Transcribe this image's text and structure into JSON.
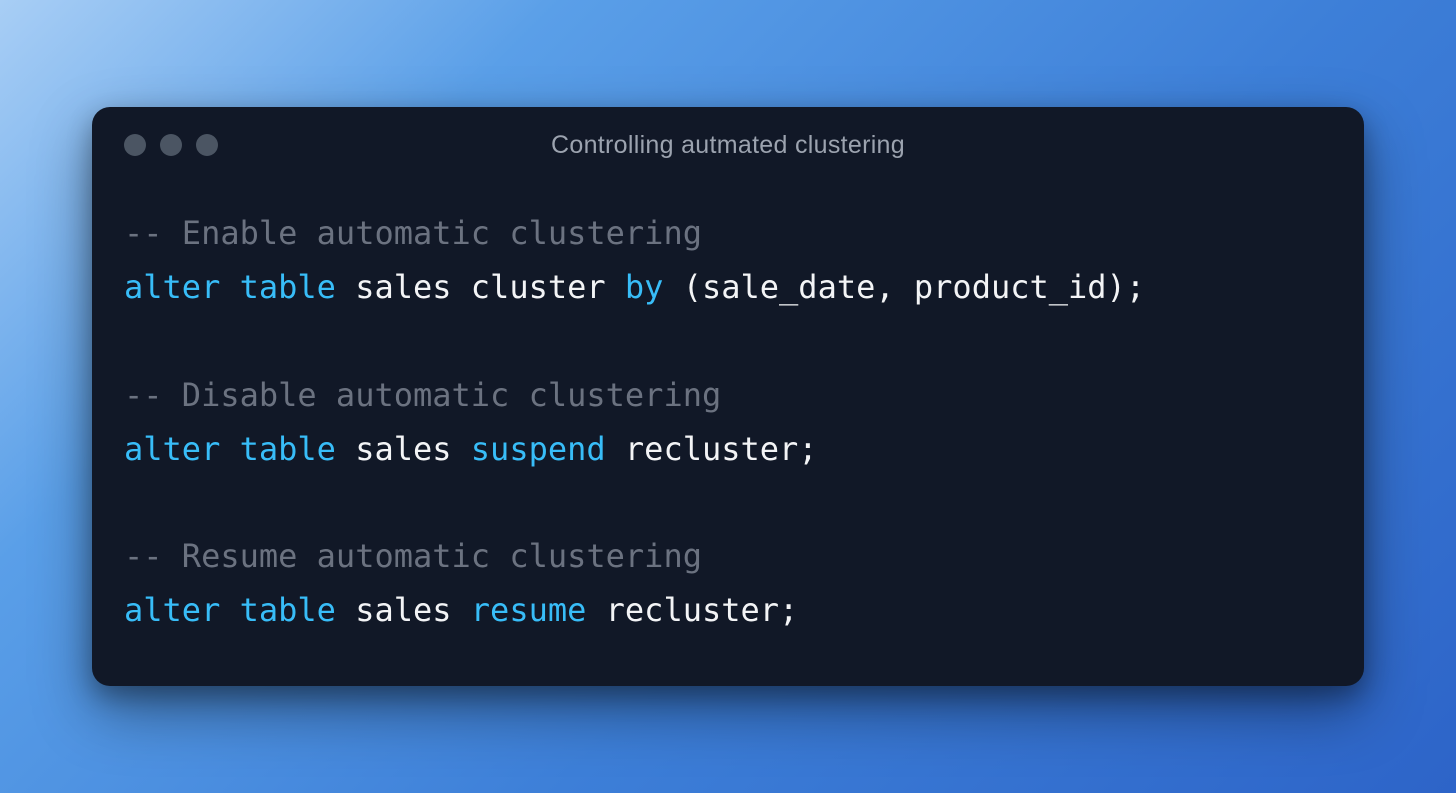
{
  "window": {
    "title": "Controlling autmated clustering"
  },
  "code": {
    "line1_comment": "-- Enable automatic clustering",
    "line2_kw1": "alter",
    "line2_kw2": "table",
    "line2_p1": " sales cluster ",
    "line2_kw3": "by",
    "line2_p2": " (sale_date, product_id);",
    "line3_comment": "-- Disable automatic clustering",
    "line4_kw1": "alter",
    "line4_kw2": "table",
    "line4_p1": " sales ",
    "line4_kw3": "suspend",
    "line4_p2": " recluster;",
    "line5_comment": "-- Resume automatic clustering",
    "line6_kw1": "alter",
    "line6_kw2": "table",
    "line6_p1": " sales ",
    "line6_kw3": "resume",
    "line6_p2": " recluster;"
  },
  "colors": {
    "windowBg": "#111827",
    "titleText": "#9ca3af",
    "trafficLight": "#4b5563",
    "comment": "#6b7280",
    "keyword": "#38bdf8",
    "plain": "#f3f4f6"
  }
}
